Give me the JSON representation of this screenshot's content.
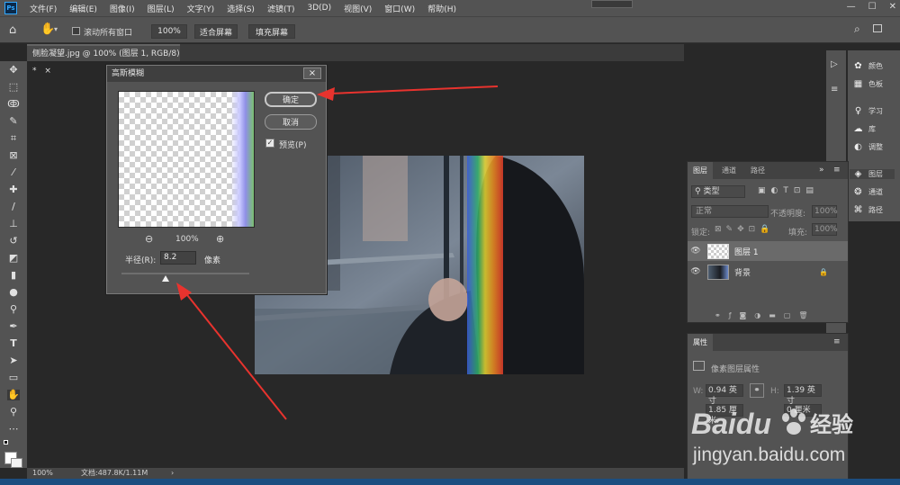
{
  "menubar": {
    "logo": "Ps",
    "items": [
      "文件(F)",
      "编辑(E)",
      "图像(I)",
      "图层(L)",
      "文字(Y)",
      "选择(S)",
      "滤镜(T)",
      "3D(D)",
      "视图(V)",
      "窗口(W)",
      "帮助(H)"
    ],
    "window_controls": [
      "—",
      "☐",
      "✕"
    ]
  },
  "options": {
    "scroll_all_label": "滚动所有窗口",
    "zoom_value": "100%",
    "fit_screen": "适合屏幕",
    "fill_screen": "填充屏幕"
  },
  "document": {
    "tab_title": "侧脸凝望.jpg @ 100% (图层 1, RGB/8) *",
    "tab_close": "×"
  },
  "dialog": {
    "title": "高斯模糊",
    "close": "×",
    "ok": "确定",
    "cancel": "取消",
    "preview_label": "预览(P)",
    "preview_checked": true,
    "zoom_out": "⊖",
    "zoom_level": "100%",
    "zoom_in": "⊕",
    "radius_label": "半径(R):",
    "radius_value": "8.2",
    "radius_unit": "像素"
  },
  "side_panel": {
    "top": [
      {
        "label": "颜色",
        "icon": "palette-icon"
      },
      {
        "label": "色板",
        "icon": "grid-icon"
      }
    ],
    "middle": [
      {
        "label": "学习",
        "icon": "bulb-icon"
      },
      {
        "label": "库",
        "icon": "cloud-icon"
      },
      {
        "label": "调整",
        "icon": "circle-half-icon"
      }
    ],
    "bottom": [
      {
        "label": "图层",
        "icon": "layers-icon"
      },
      {
        "label": "通道",
        "icon": "channels-icon"
      },
      {
        "label": "路径",
        "icon": "path-icon"
      }
    ]
  },
  "layers": {
    "tabs": [
      "图层",
      "通道",
      "路径"
    ],
    "filter_kind": "类型",
    "blend_mode": "正常",
    "opacity_label": "不透明度:",
    "opacity_value": "100%",
    "lock_label": "锁定:",
    "fill_label": "填充:",
    "fill_value": "100%",
    "items": [
      {
        "name": "图层 1",
        "selected": true
      },
      {
        "name": "背景",
        "locked": true
      }
    ],
    "footer_icons": [
      "link-icon",
      "fx-icon",
      "mask-icon",
      "adjustment-icon",
      "folder-icon",
      "new-layer-icon",
      "trash-icon"
    ]
  },
  "properties": {
    "title": "属性",
    "subtitle": "像素图层属性",
    "w_label": "W:",
    "w_value": "0.94 英寸",
    "h_label": "H:",
    "h_value": "1.39 英寸",
    "x_value": "1.85 厘米",
    "y_value": "0 厘米"
  },
  "status": {
    "zoom": "100%",
    "doc_info": "文档:487.8K/1.11M"
  },
  "watermark": {
    "brand": "Baidu",
    "cn": "经验",
    "url": "jingyan.baidu.com"
  },
  "colors": {
    "ui_bg": "#535353",
    "canvas_bg": "#282828",
    "arrow_red": "#e8332e"
  }
}
